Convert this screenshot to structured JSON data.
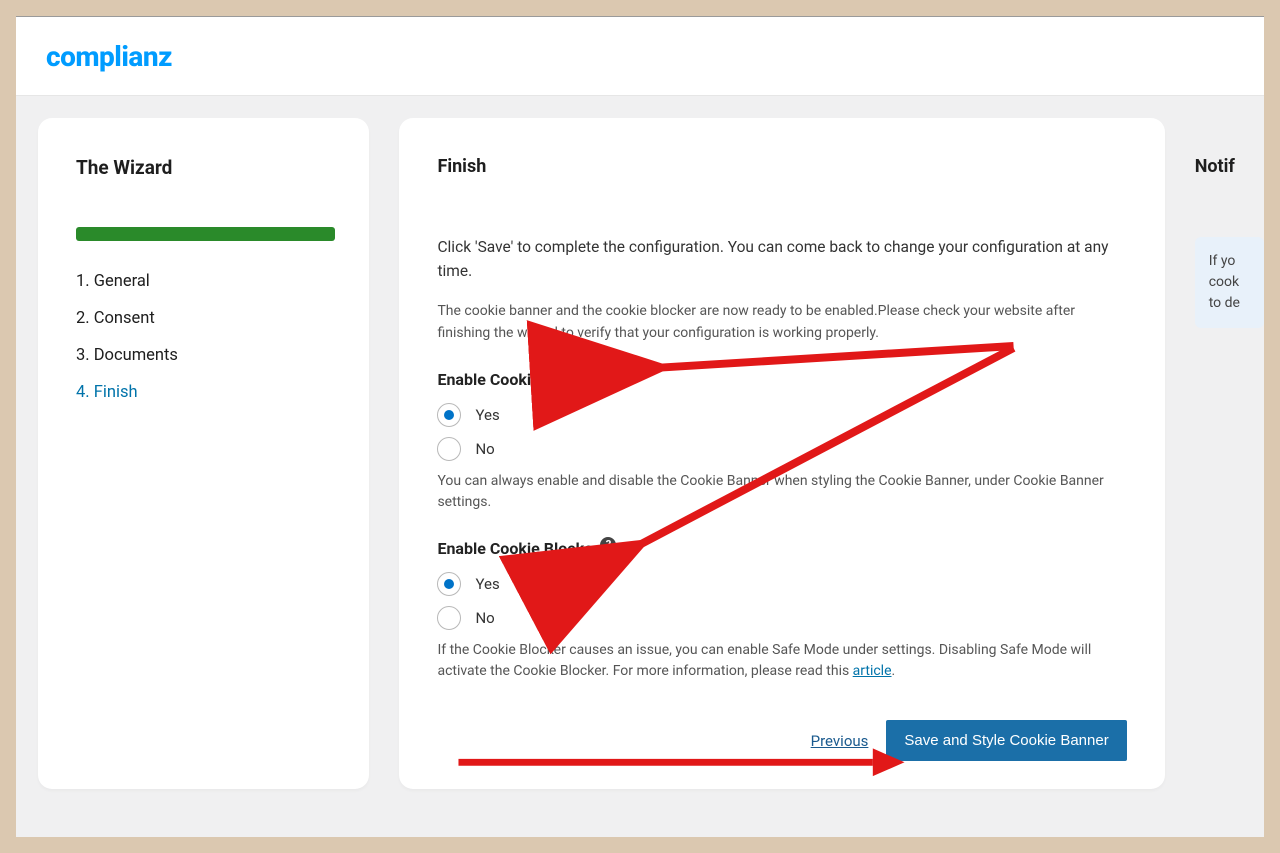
{
  "brand": "complianz",
  "sidebar": {
    "title": "The Wizard",
    "steps": [
      {
        "label": "1. General",
        "active": false
      },
      {
        "label": "2. Consent",
        "active": false
      },
      {
        "label": "3. Documents",
        "active": false
      },
      {
        "label": "4. Finish",
        "active": true
      }
    ]
  },
  "main": {
    "title": "Finish",
    "intro": "Click 'Save' to complete the configuration. You can come back to change your configuration at any time.",
    "description": "The cookie banner and the cookie blocker are now ready to be enabled.Please check your website after finishing the wizard to verify that your configuration is working properly.",
    "banner": {
      "label": "Enable Cookie Banner",
      "yes": "Yes",
      "no": "No",
      "selected": "yes",
      "hint": "You can always enable and disable the Cookie Banner when styling the Cookie Banner, under Cookie Banner settings."
    },
    "blocker": {
      "label": "Enable Cookie Blocker",
      "yes": "Yes",
      "no": "No",
      "selected": "yes",
      "hint_pre": "If the Cookie Blocker causes an issue, you can enable Safe Mode under settings. Disabling Safe Mode will activate the Cookie Blocker. For more information, please read this ",
      "hint_link": "article",
      "hint_post": "."
    },
    "prev": "Previous",
    "save": "Save and Style Cookie Banner"
  },
  "notif": {
    "title": "Notif",
    "lines": [
      "If yo",
      "cook",
      "to de"
    ]
  },
  "colors": {
    "brand_blue": "#009cff",
    "button_blue": "#1b6fa8",
    "progress_green": "#2a8a2a",
    "arrow_red": "#e11818"
  }
}
